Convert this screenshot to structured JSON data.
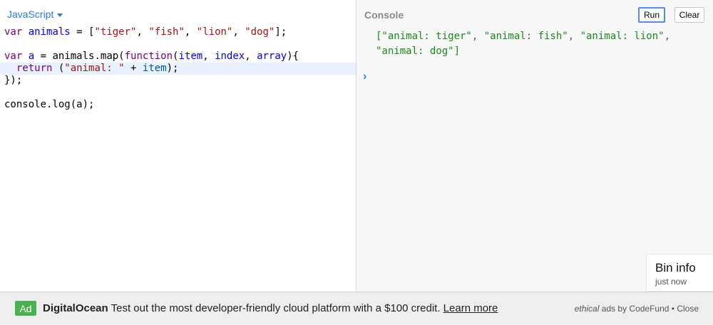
{
  "editor": {
    "language": "JavaScript",
    "code_lines": [
      "var animals = [\"tiger\", \"fish\", \"lion\", \"dog\"];",
      "",
      "var a = animals.map(function(item, index, array){",
      "  return (\"animal: \" + item);",
      "});",
      "",
      "console.log(a);"
    ],
    "active_line": 3
  },
  "console": {
    "title": "Console",
    "run_label": "Run",
    "clear_label": "Clear",
    "output_line1": "[\"animal: tiger\", \"animal: fish\", \"animal: lion\",",
    "output_line2": "\"animal: dog\"]",
    "prompt": "›"
  },
  "bin_info": {
    "title": "Bin info",
    "subtitle": "just now"
  },
  "ad": {
    "badge": "Ad",
    "brand": "DigitalOcean",
    "text": " Test out the most developer-friendly cloud platform with a $100 credit. ",
    "link": "Learn more",
    "provider_italic": "ethical",
    "provider_rest": " ads by CodeFund",
    "separator": " • ",
    "close": "Close"
  },
  "colors": {
    "accent": "#2a7ae2",
    "keyword": "#770088",
    "definition": "#0000ff",
    "string": "#aa1111",
    "console_output": "#1a8a1a",
    "ad_badge": "#4caf50"
  }
}
